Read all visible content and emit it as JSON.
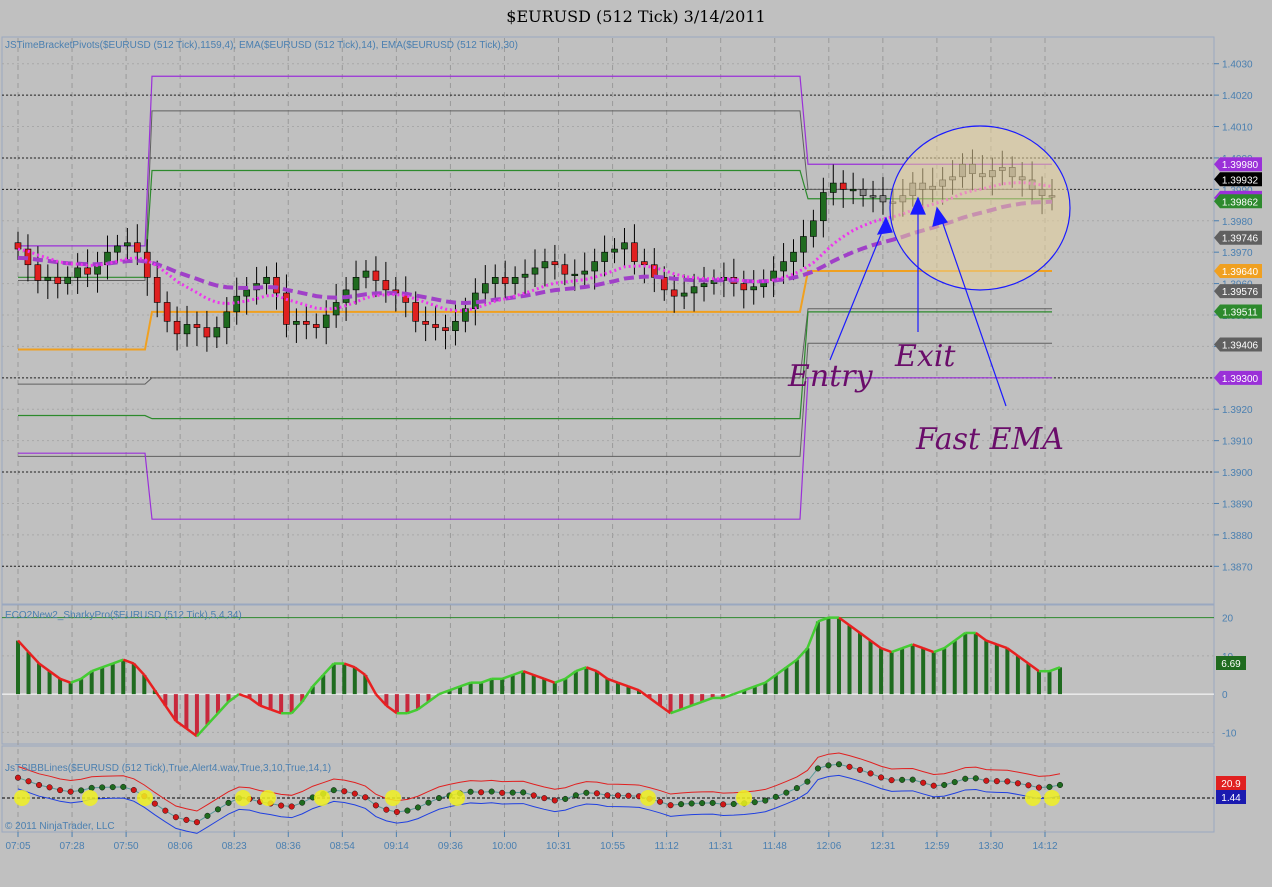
{
  "title": "$EURUSD (512 Tick)  3/14/2011",
  "copyright": "© 2011 NinjaTrader, LLC",
  "colors": {
    "background": "#c0c0c0",
    "up_candle": "#1f6b1f",
    "down_candle": "#e02020",
    "neutral_candle": "#8a8a8a",
    "pivot_purple": "#9a30d8",
    "pivot_green": "#2d8a2d",
    "pivot_orange": "#f0a020",
    "ema_fast": "#ee33ee",
    "ema_slow": "#a040c8",
    "axis_text": "#4a7fb0",
    "annotation": "#6a0d6a",
    "arrow": "#1a1aff"
  },
  "time_labels": [
    "07:05",
    "07:28",
    "07:50",
    "08:06",
    "08:23",
    "08:36",
    "08:54",
    "09:14",
    "09:36",
    "10:00",
    "10:31",
    "10:55",
    "11:12",
    "11:31",
    "11:48",
    "12:06",
    "12:31",
    "12:59",
    "13:30",
    "14:12"
  ],
  "panel_price": {
    "label": "JSTimeBracketPivots($EURUSD (512 Tick),1159,4), EMA($EURUSD (512 Tick),14), EMA($EURUSD (512 Tick),30)",
    "y_ticks": [
      "1.4030",
      "1.4020",
      "1.4010",
      "1.4000",
      "1.3990",
      "1.3980",
      "1.3970",
      "1.3960",
      "1.3950",
      "1.3940",
      "1.3930",
      "1.3920",
      "1.3910",
      "1.3900",
      "1.3890",
      "1.3880",
      "1.3870"
    ],
    "price_tags": [
      {
        "text": "1.39980",
        "value": 1.3998,
        "color": "#9a30d8"
      },
      {
        "text": "1.39932",
        "value": 1.39932,
        "color": "#000000"
      },
      {
        "text": "1.39873",
        "value": 1.39873,
        "color": "#9a30d8"
      },
      {
        "text": "1.39862",
        "value": 1.39862,
        "color": "#2d8a2d"
      },
      {
        "text": "1.39746",
        "value": 1.39746,
        "color": "#606060"
      },
      {
        "text": "1.39640",
        "value": 1.3964,
        "color": "#f0a020"
      },
      {
        "text": "1.39576",
        "value": 1.39576,
        "color": "#606060"
      },
      {
        "text": "1.39511",
        "value": 1.39511,
        "color": "#2d8a2d"
      },
      {
        "text": "1.39406",
        "value": 1.39406,
        "color": "#606060"
      },
      {
        "text": "1.39300",
        "value": 1.393,
        "color": "#9a30d8"
      }
    ],
    "annotations": {
      "entry": "Entry",
      "exit": "Exit",
      "fast_ema": "Fast EMA"
    }
  },
  "panel_osc": {
    "label": "ECO2New2_SharkyPro($EURUSD (512 Tick),5,4,34)",
    "y_ticks": [
      "20",
      "10",
      "0",
      "-10"
    ],
    "value_tag": "6.69"
  },
  "panel_bb": {
    "label": "JsTSIBBLines($EURUSD (512 Tick),True,Alert4.wav,True,3,10,True,14,1)",
    "value_tag": "1.44",
    "value_tag_top": "20.9"
  },
  "chart_data": [
    {
      "type": "candlestick",
      "title": "$EURUSD (512 Tick)  3/14/2011",
      "ylim": [
        1.3865,
        1.4035
      ],
      "close": [
        1.3971,
        1.3966,
        1.3961,
        1.3962,
        1.396,
        1.3962,
        1.3965,
        1.3963,
        1.3966,
        1.397,
        1.3972,
        1.3973,
        1.397,
        1.3962,
        1.3954,
        1.3948,
        1.3944,
        1.3947,
        1.3946,
        1.3943,
        1.3946,
        1.3951,
        1.3956,
        1.3958,
        1.396,
        1.3962,
        1.3957,
        1.3947,
        1.3948,
        1.3947,
        1.3946,
        1.395,
        1.3954,
        1.3958,
        1.3962,
        1.3964,
        1.3961,
        1.3958,
        1.3957,
        1.3954,
        1.3948,
        1.3947,
        1.3946,
        1.3945,
        1.3948,
        1.3952,
        1.3957,
        1.396,
        1.3962,
        1.396,
        1.3962,
        1.3963,
        1.3965,
        1.3967,
        1.3966,
        1.3963,
        1.3963,
        1.3964,
        1.3967,
        1.397,
        1.3971,
        1.3973,
        1.3967,
        1.3966,
        1.3962,
        1.3958,
        1.3956,
        1.3957,
        1.3959,
        1.396,
        1.3961,
        1.3962,
        1.396,
        1.3958,
        1.3959,
        1.3961,
        1.3964,
        1.3967,
        1.397,
        1.3975,
        1.398,
        1.3989,
        1.3992,
        1.399,
        1.399,
        1.3988,
        1.3988,
        1.3986,
        1.3986,
        1.3988,
        1.3992,
        1.399,
        1.3991,
        1.3993,
        1.3994,
        1.3998,
        1.3995,
        1.3994,
        1.3996,
        1.3997,
        1.3994,
        1.3993,
        1.399,
        1.3988,
        1.3988
      ],
      "ema_fast_period": 14,
      "ema_slow_period": 30,
      "pivot_levels": [
        1.4026,
        1.4015,
        1.3998,
        1.399,
        1.398,
        1.3964,
        1.3951,
        1.3941,
        1.393,
        1.392,
        1.3901,
        1.3885
      ]
    },
    {
      "type": "bar",
      "title": "ECO2New2_SharkyPro",
      "ylim": [
        -12,
        22
      ],
      "values": [
        14,
        11,
        8,
        6,
        4,
        3,
        4,
        6,
        7,
        8,
        9,
        8,
        5,
        1,
        -3,
        -7,
        -9,
        -11,
        -8,
        -5,
        -2,
        0,
        -1,
        -3,
        -4,
        -5,
        -5,
        -2,
        2,
        5,
        8,
        8,
        7,
        5,
        0,
        -3,
        -5,
        -5,
        -4,
        -2,
        0,
        1,
        2,
        3,
        3,
        4,
        4,
        5,
        6,
        5,
        4,
        3,
        4,
        6,
        7,
        6,
        4,
        3,
        2,
        1,
        -1,
        -3,
        -5,
        -4,
        -3,
        -2,
        -1,
        -1,
        0,
        1,
        2,
        3,
        5,
        7,
        9,
        12,
        19,
        20,
        20,
        18,
        16,
        14,
        12,
        11,
        12,
        13,
        12,
        11,
        12,
        14,
        16,
        16,
        14,
        13,
        12,
        10,
        8,
        6,
        6,
        7
      ]
    }
  ]
}
